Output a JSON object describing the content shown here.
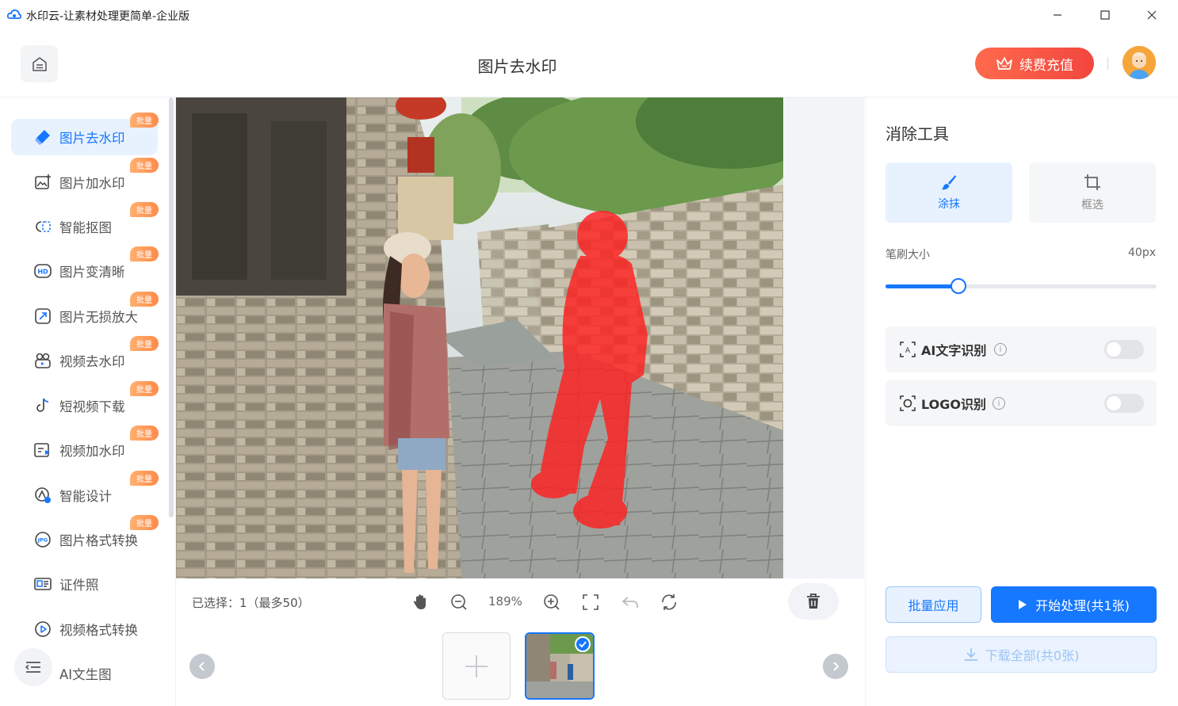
{
  "window": {
    "title": "水印云-让素材处理更简单-企业版"
  },
  "header": {
    "page_title": "图片去水印",
    "recharge_label": "续费充值"
  },
  "sidebar": {
    "items": [
      {
        "label": "图片去水印",
        "badge": "批量",
        "icon": "eraser-icon",
        "active": true
      },
      {
        "label": "图片加水印",
        "badge": "批量",
        "icon": "image-add-icon"
      },
      {
        "label": "智能抠图",
        "badge": "批量",
        "icon": "cutout-icon"
      },
      {
        "label": "图片变清晰",
        "badge": "批量",
        "icon": "hd-icon"
      },
      {
        "label": "图片无损放大",
        "badge": "批量",
        "icon": "enlarge-icon"
      },
      {
        "label": "视频去水印",
        "badge": "批量",
        "icon": "video-eraser-icon"
      },
      {
        "label": "短视频下载",
        "badge": "批量",
        "icon": "tiktok-icon"
      },
      {
        "label": "视频加水印",
        "badge": "批量",
        "icon": "video-add-icon"
      },
      {
        "label": "智能设计",
        "badge": "批量",
        "icon": "design-icon"
      },
      {
        "label": "图片格式转换",
        "badge": "批量",
        "icon": "jpg-icon"
      },
      {
        "label": "证件照",
        "badge": "",
        "icon": "id-card-icon"
      },
      {
        "label": "视频格式转换",
        "badge": "",
        "icon": "play-circle-icon"
      },
      {
        "label": "AI文生图",
        "badge": "",
        "icon": "ai-image-icon"
      }
    ]
  },
  "toolbar": {
    "selection_text": "已选择：1（最多50）",
    "zoom": "189%"
  },
  "right_panel": {
    "title": "消除工具",
    "tools": [
      {
        "label": "涂抹",
        "active": true
      },
      {
        "label": "框选",
        "active": false
      }
    ],
    "brush_label": "笔刷大小",
    "brush_value": "40px",
    "brush_level": 0.27,
    "options": [
      {
        "label": "AI文字识别",
        "enabled": false
      },
      {
        "label": "LOGO识别",
        "enabled": false
      }
    ],
    "batch_label": "批量应用",
    "start_label": "开始处理(共1张)",
    "download_label": "下载全部(共0张)"
  },
  "colors": {
    "accent": "#1677ff",
    "recharge": "#f2463e",
    "badge": "#ff8a4a",
    "mask": "#ff2020"
  }
}
